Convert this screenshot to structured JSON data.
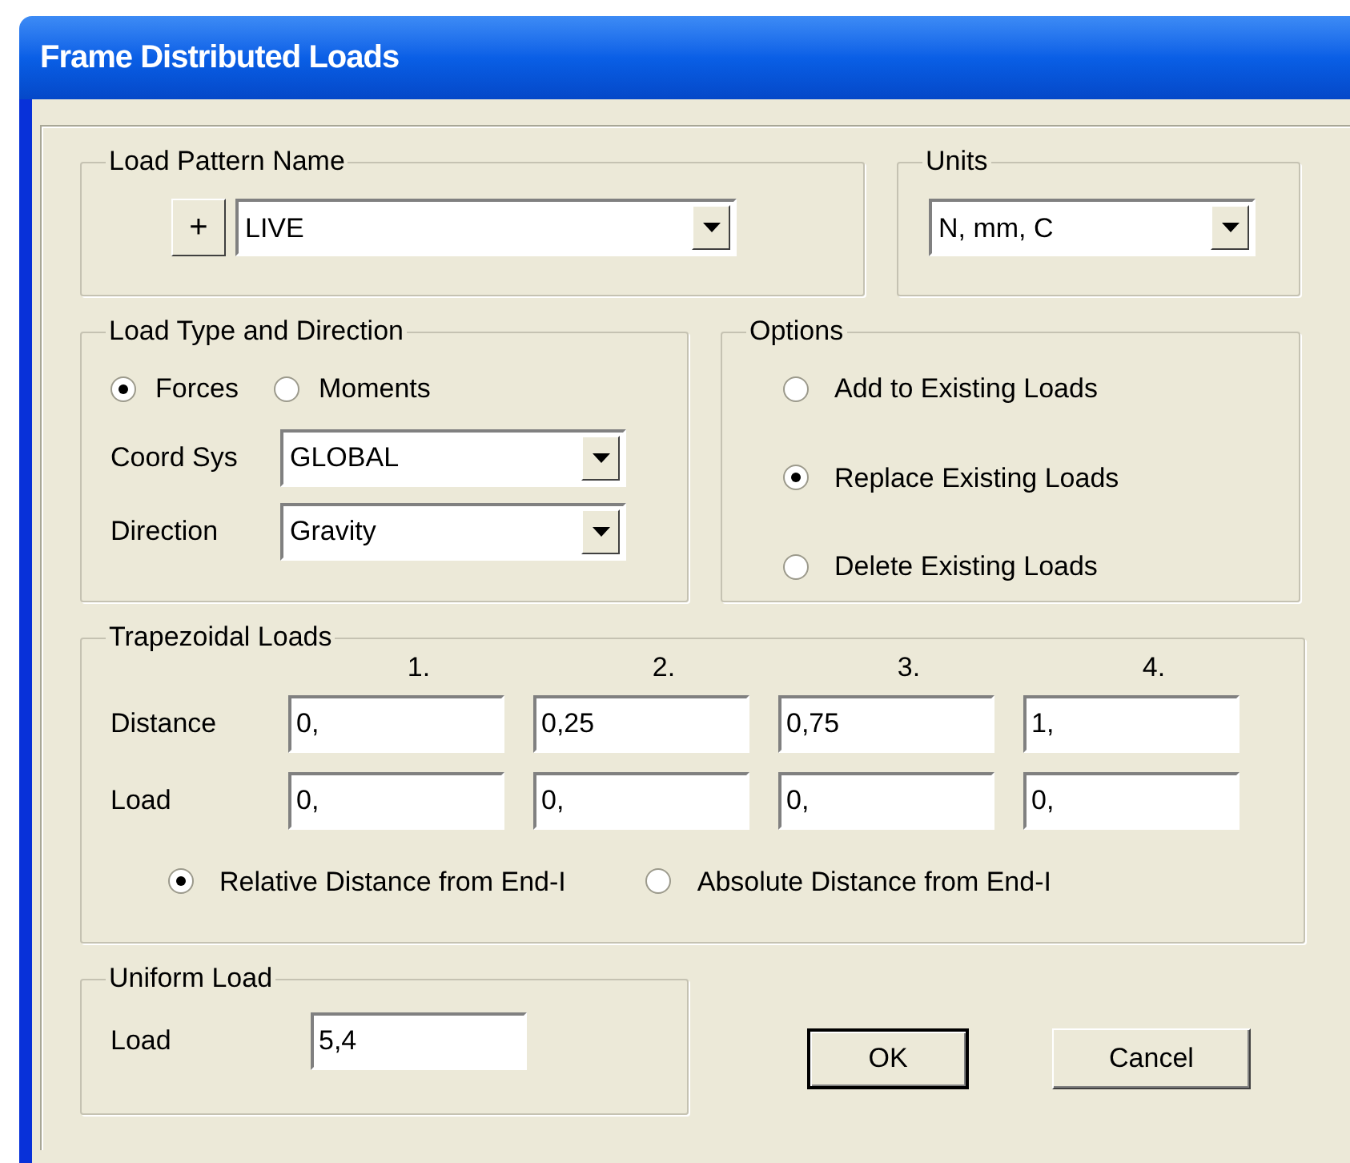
{
  "window": {
    "title": "Frame Distributed Loads"
  },
  "load_pattern": {
    "legend": "Load Pattern Name",
    "add_button": "+",
    "value": "LIVE"
  },
  "units": {
    "legend": "Units",
    "value": "N, mm, C"
  },
  "load_type": {
    "legend": "Load Type and Direction",
    "types": [
      {
        "label": "Forces",
        "selected": true
      },
      {
        "label": "Moments",
        "selected": false
      }
    ],
    "fields": [
      {
        "label": "Coord Sys",
        "value": "GLOBAL"
      },
      {
        "label": "Direction",
        "value": "Gravity"
      }
    ]
  },
  "options": {
    "legend": "Options",
    "items": [
      {
        "label": "Add to Existing Loads",
        "selected": false
      },
      {
        "label": "Replace Existing Loads",
        "selected": true
      },
      {
        "label": "Delete Existing Loads",
        "selected": false
      }
    ]
  },
  "trapezoidal": {
    "legend": "Trapezoidal Loads",
    "columns": [
      "1.",
      "2.",
      "3.",
      "4."
    ],
    "rows": [
      {
        "label": "Distance",
        "values": [
          "0,",
          "0,25",
          "0,75",
          "1,"
        ]
      },
      {
        "label": "Load",
        "values": [
          "0,",
          "0,",
          "0,",
          "0,"
        ]
      }
    ],
    "distance_modes": [
      {
        "label": "Relative Distance from End-I",
        "selected": true
      },
      {
        "label": "Absolute Distance from End-I",
        "selected": false
      }
    ]
  },
  "uniform": {
    "legend": "Uniform Load",
    "label": "Load",
    "value": "5,4"
  },
  "buttons": [
    {
      "label": "OK",
      "default": true
    },
    {
      "label": "Cancel",
      "default": false
    }
  ]
}
